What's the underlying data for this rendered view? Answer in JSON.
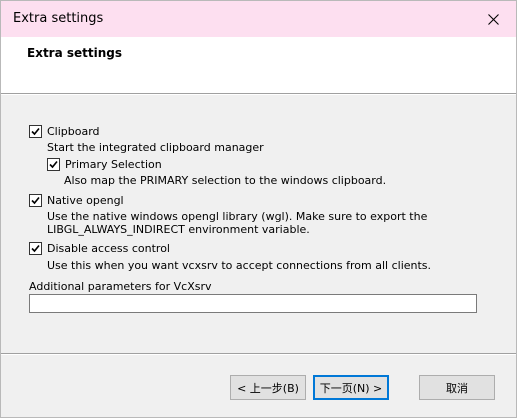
{
  "window": {
    "title": "Extra settings",
    "close_icon": "close-icon"
  },
  "header": {
    "title": "Extra settings"
  },
  "options": {
    "clipboard": {
      "label": "Clipboard",
      "checked": true,
      "description": "Start the integrated clipboard manager"
    },
    "primary_selection": {
      "label": "Primary Selection",
      "checked": true,
      "description": "Also map the PRIMARY selection to the windows clipboard."
    },
    "native_opengl": {
      "label": "Native opengl",
      "checked": true,
      "description_line1": "Use the native windows opengl library (wgl). Make sure to export the",
      "description_line2": "LIBGL_ALWAYS_INDIRECT environment variable."
    },
    "disable_access_control": {
      "label": "Disable access control",
      "checked": true,
      "description": "Use this when you want vcxsrv to accept connections from all clients."
    }
  },
  "additional_params": {
    "label": "Additional parameters for VcXsrv",
    "value": ""
  },
  "buttons": {
    "back": "< 上一步(B)",
    "next": "下一页(N) >",
    "cancel": "取消"
  }
}
